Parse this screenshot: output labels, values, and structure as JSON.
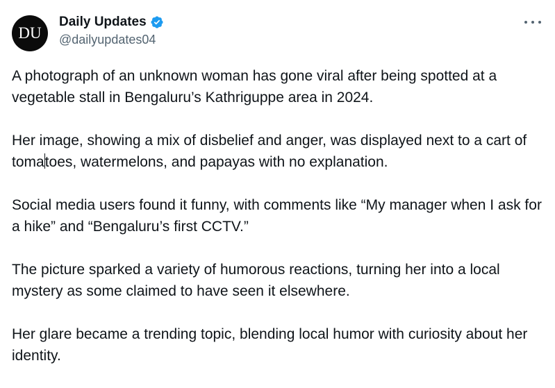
{
  "author": {
    "avatar_text": "DU",
    "name": "Daily Updates",
    "handle": "@dailyupdates04",
    "verified_icon": "verified-badge-icon",
    "verified_color": "#1d9bf0"
  },
  "menu": {
    "icon": "more-options-icon"
  },
  "tweet": {
    "paragraphs": [
      "A photograph of an unknown woman has gone viral after being spotted at a vegetable stall in Bengaluru’s Kathriguppe area in 2024.",
      "Her image, showing a mix of disbelief and anger, was displayed next to a cart of toma",
      "toes, watermelons, and papayas with no explanation.",
      "Social media users found it funny, with comments like “My manager when I ask for a hike” and “Bengaluru’s first CCTV.”",
      "The picture sparked a variety of humorous reactions, turning her into a local mystery as some claimed to have seen it elsewhere.",
      "Her glare became a trending topic, blending local humor with curiosity about her identity."
    ]
  }
}
